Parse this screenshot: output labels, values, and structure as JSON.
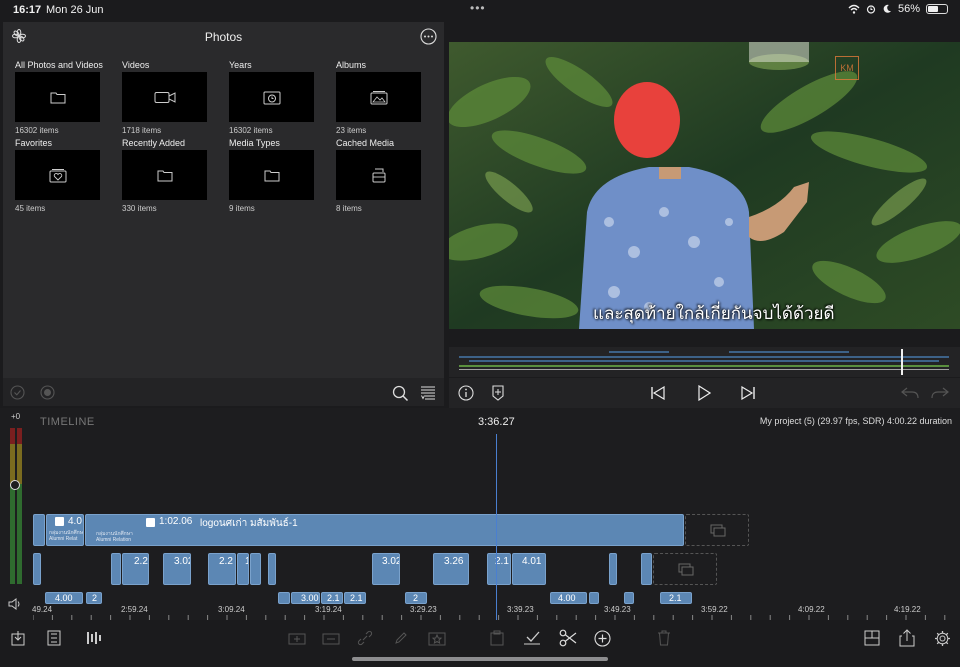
{
  "status": {
    "time": "16:17",
    "date": "Mon 26 Jun",
    "battery": "56%",
    "battery_level": 0.56
  },
  "photos": {
    "title": "Photos",
    "items": [
      {
        "label": "All Photos and Videos",
        "count": "16302 items",
        "icon": "folder-icon"
      },
      {
        "label": "Videos",
        "count": "1718 items",
        "icon": "video-camera-icon"
      },
      {
        "label": "Years",
        "count": "16302 items",
        "icon": "calendar-clock-icon"
      },
      {
        "label": "Albums",
        "count": "23 items",
        "icon": "albums-icon"
      },
      {
        "label": "Favorites",
        "count": "45 items",
        "icon": "heart-album-icon"
      },
      {
        "label": "Recently Added",
        "count": "330 items",
        "icon": "folder-icon"
      },
      {
        "label": "Media Types",
        "count": "9 items",
        "icon": "folder-icon"
      },
      {
        "label": "Cached Media",
        "count": "8 items",
        "icon": "stack-icon"
      }
    ]
  },
  "viewer": {
    "subtitle": "และสุดท้ายใกล้เกี่ยกันจบได้ด้วยดี"
  },
  "timeline": {
    "label": "TIMELINE",
    "playhead_time": "3:36.27",
    "project_info": "My project (5) (29.97 fps, SDR)  4:00.22 duration",
    "meter_label": "+0",
    "main_clip": {
      "duration": "1:02.06",
      "name": "logoนศเก่า มสัมพันธ์-1"
    },
    "first_clip": {
      "duration": "4.0",
      "sub1": "กลุ่มงานนักศึกษา",
      "sub2": "Alumni Relat"
    },
    "clip_sub1": "กลุ่มงานนักศึกษา",
    "clip_sub2": "Alumni Relation",
    "row2_clips": [
      "2.2",
      "3.02",
      "2.2",
      "1",
      "3.02",
      "3.26",
      "2.1",
      "4.01"
    ],
    "row3_clips": [
      "4.00",
      "2",
      "3.00",
      "2.1",
      "2.1",
      "2",
      "4.00",
      "2.1"
    ],
    "ruler": [
      "49.24",
      "2:59.24",
      "3:09.24",
      "3:19.24",
      "3:29.23",
      "3:39.23",
      "3:49.23",
      "3:59.22",
      "4:09.22",
      "4:19.22"
    ]
  },
  "colors": {
    "accent": "#5c87b4",
    "playhead": "#4a7fd0",
    "panel": "#2a2a2c"
  }
}
